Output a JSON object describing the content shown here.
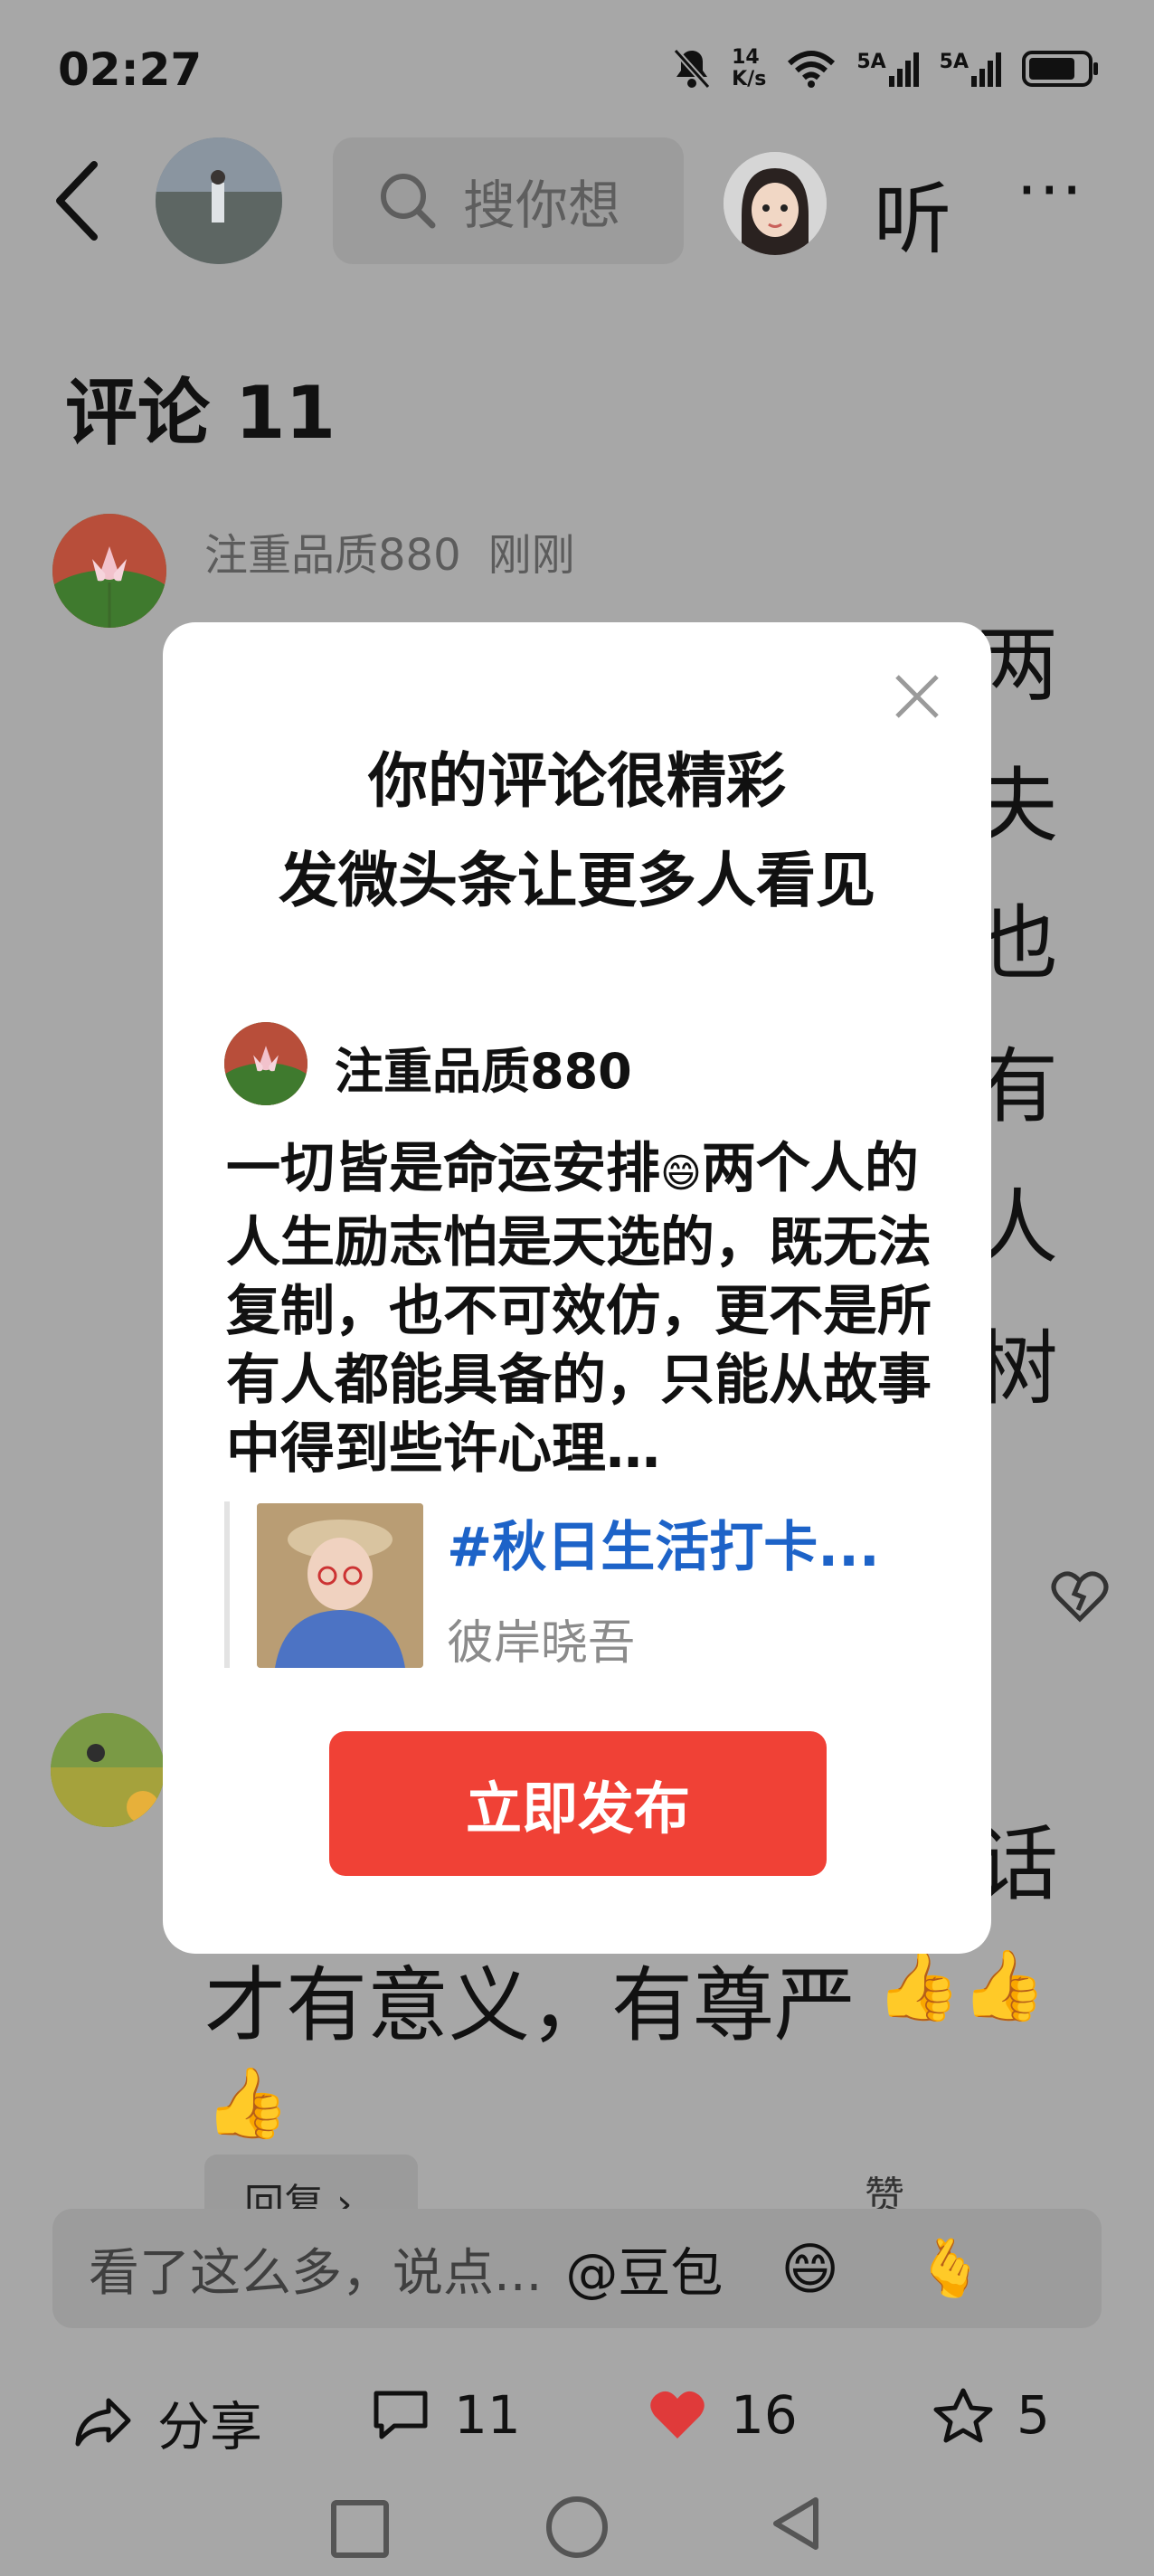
{
  "status_bar": {
    "time": "02:27",
    "net_speed_top": "14",
    "net_speed_unit": "K/s",
    "sim1_label": "5A",
    "sim2_label": "5A",
    "icons": [
      "bell-off-icon",
      "wifi-icon",
      "signal-icon",
      "signal-icon",
      "battery-icon"
    ]
  },
  "top_bar": {
    "search_placeholder": "搜你想",
    "listen_label": "听",
    "more_label": "···"
  },
  "comments": {
    "title": "评论 11",
    "first": {
      "author": "注重品质880",
      "time": "刚刚",
      "visible_fragments": [
        "一切皆是命运安排",
        "两",
        "夫",
        "也",
        "有",
        "人",
        "树"
      ]
    },
    "second": {
      "visible_fragments": [
        "话",
        "才有意义，有尊严"
      ]
    },
    "reply_label": "回复 ›",
    "like_label": "赞"
  },
  "modal": {
    "title_line1": "你的评论很精彩",
    "title_line2": "发微头条让更多人看见",
    "author": "注重品质880",
    "body": "一切皆是命运安排😄两个人的人生励志怕是天选的，既无法复制，也不可效仿，更不是所有人都能具备的，只能从故事中得到些许心理…",
    "body_parts": {
      "before_emoji": "一切皆是命运安排",
      "emoji": "😄",
      "after_emoji": "两个人的人生励志怕是天选的，既无法复制，也不可效仿，更不是所有人都能具备的，只能从故事中得到些许心理…"
    },
    "quote_tag": "#秋日生活打卡...",
    "quote_author": "彼岸晓吾",
    "publish_label": "立即发布"
  },
  "input_bar": {
    "placeholder": "看了这么多，说点...",
    "mention": "@豆包",
    "emoji": "😄",
    "gift": "🫰"
  },
  "action_bar": {
    "share_label": "分享",
    "comment_count": "11",
    "like_count": "16",
    "favorite_count": "5"
  },
  "colors": {
    "overlay_bg": "#a7a7a7",
    "publish_button": "#f04136",
    "quote_link": "#1d63c8",
    "heart": "#e03a3a"
  }
}
